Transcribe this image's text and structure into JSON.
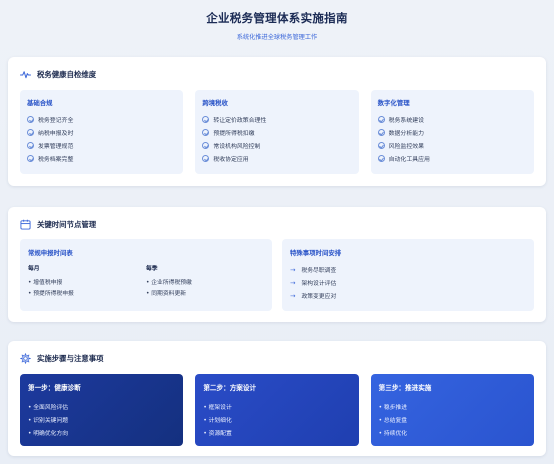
{
  "header": {
    "title": "企业税务管理体系实施指南",
    "subtitle": "系统化推进全球税务管理工作"
  },
  "health": {
    "title": "税务健康自检维度",
    "panels": [
      {
        "title": "基础合规",
        "items": [
          "税务登记齐全",
          "纳税申报及时",
          "发票管理规范",
          "税务档案完整"
        ]
      },
      {
        "title": "跨境税收",
        "items": [
          "转让定价政策合理性",
          "预提所得税扣缴",
          "常设机构风险控制",
          "税收协定应用"
        ]
      },
      {
        "title": "数字化管理",
        "items": [
          "税务系统建设",
          "数据分析能力",
          "风险监控效果",
          "自动化工具应用"
        ]
      }
    ]
  },
  "timeline": {
    "title": "关键时间节点管理",
    "regular": {
      "title": "常规申报时间表",
      "monthly": {
        "label": "每月",
        "items": [
          "• 增值税申报",
          "• 预提所得税申报"
        ]
      },
      "quarterly": {
        "label": "每季",
        "items": [
          "• 企业所得税预缴",
          "• 同期资料更新"
        ]
      }
    },
    "special": {
      "title": "特殊事项时间安排",
      "items": [
        "税务尽职调查",
        "架构设计评估",
        "政策变更应对"
      ]
    }
  },
  "steps": {
    "title": "实施步骤与注意事项",
    "list": [
      {
        "title": "第一步：健康诊断",
        "items": [
          "• 全面风险评估",
          "• 识别关键问题",
          "• 明确优化方向"
        ]
      },
      {
        "title": "第二步：方案设计",
        "items": [
          "• 框架设计",
          "• 计划细化",
          "• 资源配置"
        ]
      },
      {
        "title": "第三步：推进实施",
        "items": [
          "• 稳步推进",
          "• 总结复盘",
          "• 持续优化"
        ]
      }
    ]
  },
  "colors": {
    "accent": "#3a66d9",
    "panel_bg": "#eef3fc",
    "dark_blue": "#14307f"
  },
  "icons": {
    "health": "pulse-icon",
    "timeline": "calendar-icon",
    "steps": "gear-icon",
    "item_check": "check-circle-icon",
    "item_arrow": "arrow-right-icon"
  }
}
